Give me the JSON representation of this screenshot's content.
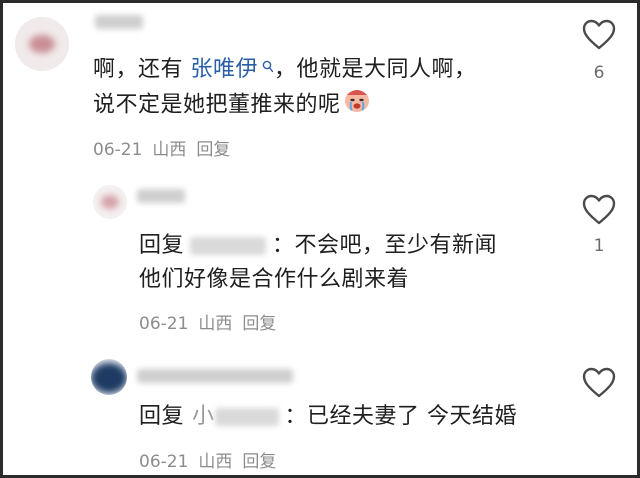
{
  "comments": [
    {
      "text_prefix": "啊，还有 ",
      "mention": "张唯伊",
      "mention_icon": "search-icon",
      "text_line1_suffix": "，他就是大同人啊，",
      "text_line2": "说不定是她把董推来的呢",
      "emoji": "crying-face-emoji",
      "date": "06-21",
      "location": "山西",
      "reply_label": "回复",
      "likes": "6"
    },
    {
      "reply_prefix": "回复",
      "text_line1_suffix": "：不会吧，至少有新闻",
      "text_line2": "他们好像是合作什么剧来着",
      "date": "06-21",
      "location": "山西",
      "reply_label": "回复",
      "likes": "1"
    },
    {
      "reply_prefix": "回复",
      "reply_target_initial": "小",
      "text_line1_suffix": "：已经夫妻了 今天结婚",
      "date": "06-21",
      "location": "山西",
      "reply_label": "回复",
      "likes": ""
    }
  ],
  "colors": {
    "mention": "#2a5fa8",
    "meta": "#8c8c8c",
    "border": "#2b2b2b"
  }
}
